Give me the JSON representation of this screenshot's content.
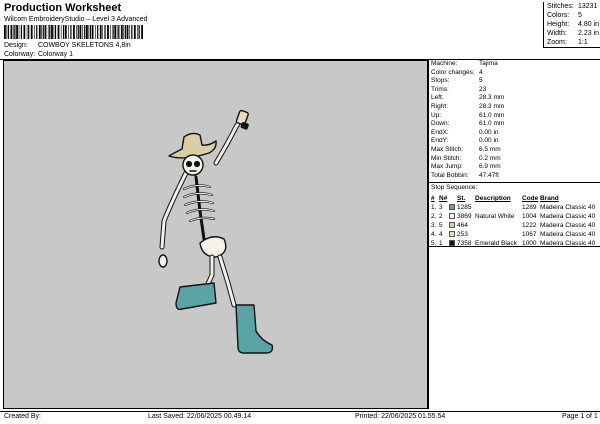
{
  "header": {
    "title": "Production Worksheet",
    "subtitle": "Wilcom EmbroideryStudio – Level 3 Advanced",
    "design_label": "Design:",
    "design_value": "COWBOY SKELETONS 4,8in",
    "colorway_label": "Colorway:",
    "colorway_value": "Colorway 1"
  },
  "summary": [
    {
      "label": "Stitches:",
      "value": "13231"
    },
    {
      "label": "Colors:",
      "value": "5"
    },
    {
      "label": "Height:",
      "value": "4.80 in"
    },
    {
      "label": "Width:",
      "value": "2.23 in"
    },
    {
      "label": "Zoom:",
      "value": "1:1"
    }
  ],
  "params": [
    {
      "label": "Machine:",
      "value": "Tajima"
    },
    {
      "label": "Color changes:",
      "value": "4"
    },
    {
      "label": "Stops:",
      "value": "5"
    },
    {
      "label": "Trims:",
      "value": "23"
    },
    {
      "label": "Left:",
      "value": "28.3 mm"
    },
    {
      "label": "Right:",
      "value": "28.3 mm"
    },
    {
      "label": "Up:",
      "value": "61.0 mm"
    },
    {
      "label": "Down:",
      "value": "61.0 mm"
    },
    {
      "label": "EndX:",
      "value": "0.00 in"
    },
    {
      "label": "EndY:",
      "value": "0.00 in"
    },
    {
      "label": "Max Stitch:",
      "value": "6.5 mm"
    },
    {
      "label": "Min Stitch:",
      "value": "0.2 mm"
    },
    {
      "label": "Max Jump:",
      "value": "6.9 mm"
    },
    {
      "label": "Total Bobbin:",
      "value": "47.47ft"
    }
  ],
  "stop_sequence": {
    "title": "Stop Sequence:",
    "headers": {
      "num": "#",
      "n": "N#",
      "st": "St.",
      "desc": "Description",
      "code": "Code",
      "brand": "Brand"
    },
    "rows": [
      {
        "num": "1.",
        "n": "3",
        "color": "#5aa3a6",
        "st": "1285",
        "desc": "",
        "code": "1289",
        "brand": "Madeira Classic 40"
      },
      {
        "num": "2.",
        "n": "2",
        "color": "#f3f1ea",
        "st": "3869",
        "desc": "Natural White",
        "code": "1004",
        "brand": "Madeira Classic 40"
      },
      {
        "num": "3.",
        "n": "5",
        "color": "#d8cfa6",
        "st": "464",
        "desc": "",
        "code": "1222",
        "brand": "Madeira Classic 40"
      },
      {
        "num": "4.",
        "n": "4",
        "color": "#e9dcc0",
        "st": "253",
        "desc": "",
        "code": "1067",
        "brand": "Madeira Classic 40"
      },
      {
        "num": "5.",
        "n": "1",
        "color": "#111111",
        "st": "7358",
        "desc": "Emerald Black",
        "code": "1000",
        "brand": "Madeira Classic 40"
      }
    ]
  },
  "footer": {
    "created_by": "Created By:",
    "last_saved": "Last Saved: 22/06/2025 00.49.14",
    "printed": "Printed: 22/06/2025 01.55.54",
    "page": "Page 1 of 1"
  },
  "colors": {
    "canvas_bg": "#c8c8c8",
    "boot": "#5aa3a6",
    "bone": "#f3f1ea",
    "hat": "#d8cfa6",
    "bottle": "#e9dcc0",
    "outline": "#111111"
  }
}
